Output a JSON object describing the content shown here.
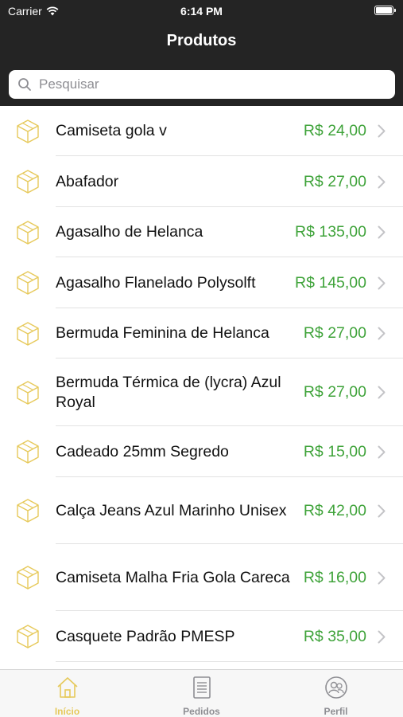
{
  "status_bar": {
    "carrier": "Carrier",
    "time": "6:14 PM"
  },
  "nav": {
    "title": "Produtos"
  },
  "search": {
    "placeholder": "Pesquisar",
    "value": ""
  },
  "colors": {
    "accent": "#e6c95a",
    "price": "#3fa33a",
    "header": "#242424"
  },
  "products": [
    {
      "name": "Camiseta gola v",
      "price": "R$ 24,00"
    },
    {
      "name": "Abafador",
      "price": "R$ 27,00"
    },
    {
      "name": "Agasalho de Helanca",
      "price": "R$ 135,00"
    },
    {
      "name": "Agasalho Flanelado Polysolft",
      "price": "R$ 145,00"
    },
    {
      "name": "Bermuda Feminina de Helanca",
      "price": "R$ 27,00"
    },
    {
      "name": "Bermuda Térmica de (lycra) Azul Royal",
      "price": "R$ 27,00"
    },
    {
      "name": "Cadeado 25mm Segredo",
      "price": "R$ 15,00"
    },
    {
      "name": "Calça Jeans Azul Marinho Unisex",
      "price": "R$ 42,00"
    },
    {
      "name": "Camiseta Malha Fria Gola Careca",
      "price": "R$ 16,00"
    },
    {
      "name": "Casquete Padrão PMESP",
      "price": "R$ 35,00"
    }
  ],
  "tabs": [
    {
      "label": "Início",
      "icon": "home-icon",
      "active": true
    },
    {
      "label": "Pedidos",
      "icon": "orders-icon",
      "active": false
    },
    {
      "label": "Perfil",
      "icon": "profile-icon",
      "active": false
    }
  ]
}
